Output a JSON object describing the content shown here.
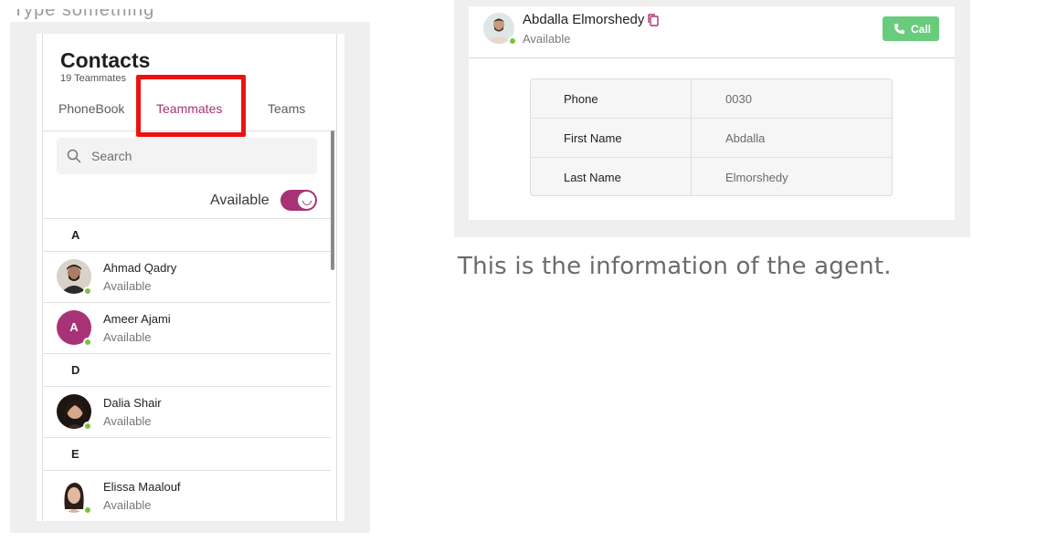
{
  "left_frame": {
    "top_fragment": "Type something",
    "contacts": {
      "title": "Contacts",
      "subtitle": "19 Teammates",
      "tabs": [
        "PhoneBook",
        "Teammates",
        "Teams"
      ],
      "active_tab": "Teammates",
      "search_placeholder": "Search",
      "availability_label": "Available",
      "availability_on": true,
      "groups": [
        {
          "letter": "A",
          "members": [
            {
              "name": "Ahmad Qadry",
              "status": "Available",
              "avatar": "photo"
            },
            {
              "name": "Ameer Ajami",
              "status": "Available",
              "avatar": "A"
            }
          ]
        },
        {
          "letter": "D",
          "members": [
            {
              "name": "Dalia Shair",
              "status": "Available",
              "avatar": "photo"
            }
          ]
        },
        {
          "letter": "E",
          "members": [
            {
              "name": "Elissa Maalouf",
              "status": "Available",
              "avatar": "photo"
            }
          ]
        }
      ]
    }
  },
  "right_frame": {
    "agent": {
      "name": "Abdalla Elmorshedy",
      "status": "Available",
      "call_label": "Call"
    },
    "fields": [
      {
        "key": "Phone",
        "value": "0030"
      },
      {
        "key": "First Name",
        "value": "Abdalla"
      },
      {
        "key": "Last Name",
        "value": "Elmorshedy"
      }
    ]
  },
  "caption": "This is the information of the agent.",
  "colors": {
    "brand": "#a83276",
    "online": "#7ac143",
    "call": "#69cc7d",
    "highlight": "#ee1111"
  }
}
